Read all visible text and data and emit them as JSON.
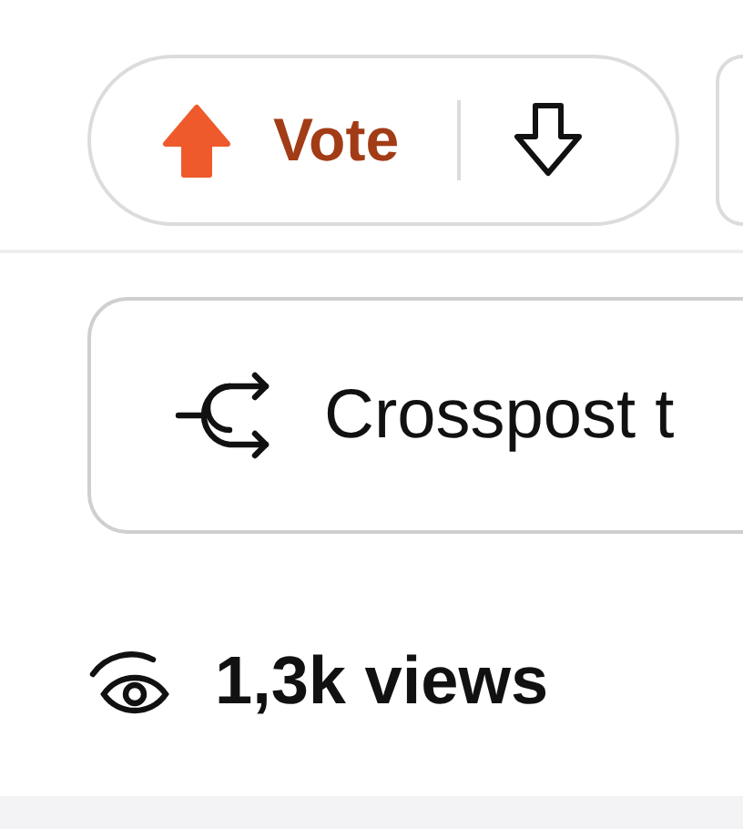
{
  "vote": {
    "label": "Vote",
    "upvoted": true
  },
  "crosspost": {
    "label": "Crosspost t"
  },
  "views": {
    "label": "1,3k views"
  }
}
